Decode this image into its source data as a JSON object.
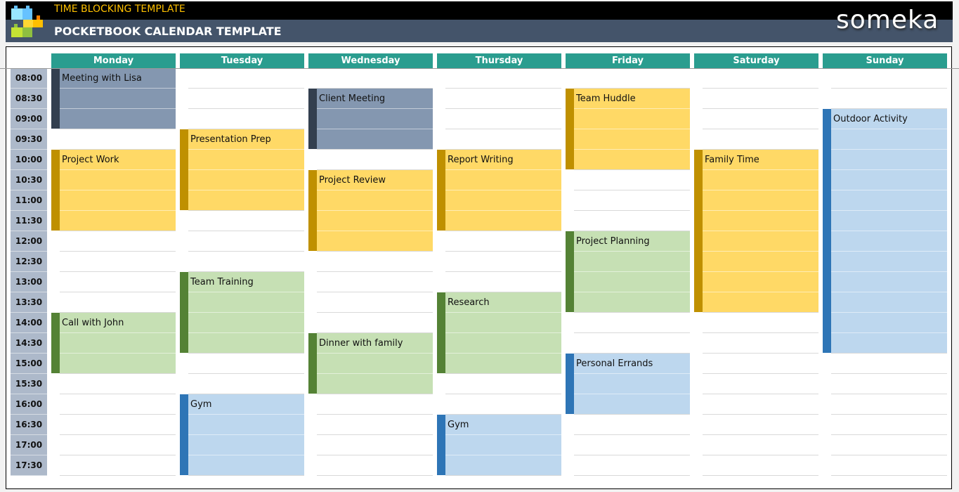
{
  "header": {
    "subtitle": "TIME BLOCKING TEMPLATE",
    "title": "POCKETBOOK CALENDAR TEMPLATE",
    "brand": "someka"
  },
  "colors": {
    "teal": "#2a9d8f",
    "slate": "#8497b0",
    "yellow": "#ffd966",
    "green": "#c6e0b4",
    "blue": "#bdd7ee"
  },
  "categories": {
    "slate": {
      "fill": "#8497b0",
      "bar": "#333f4f"
    },
    "yellow": {
      "fill": "#ffd966",
      "bar": "#bf9000"
    },
    "green": {
      "fill": "#c6e0b4",
      "bar": "#548235"
    },
    "blue": {
      "fill": "#bdd7ee",
      "bar": "#2e75b6"
    }
  },
  "days": [
    "Monday",
    "Tuesday",
    "Wednesday",
    "Thursday",
    "Friday",
    "Saturday",
    "Sunday"
  ],
  "times": [
    "08:00",
    "08:30",
    "09:00",
    "09:30",
    "10:00",
    "10:30",
    "11:00",
    "11:30",
    "12:00",
    "12:30",
    "13:00",
    "13:30",
    "14:00",
    "14:30",
    "15:00",
    "15:30",
    "16:00",
    "16:30",
    "17:00",
    "17:30"
  ],
  "events": [
    {
      "day": "Monday",
      "title": "Meeting with Lisa",
      "start": "08:00",
      "end": "09:30",
      "cat": "slate"
    },
    {
      "day": "Monday",
      "title": "Project Work",
      "start": "10:00",
      "end": "12:00",
      "cat": "yellow"
    },
    {
      "day": "Monday",
      "title": "Call with John",
      "start": "14:00",
      "end": "15:30",
      "cat": "green"
    },
    {
      "day": "Tuesday",
      "title": "Presentation Prep",
      "start": "09:30",
      "end": "11:30",
      "cat": "yellow"
    },
    {
      "day": "Tuesday",
      "title": "Team Training",
      "start": "13:00",
      "end": "15:00",
      "cat": "green"
    },
    {
      "day": "Tuesday",
      "title": "Gym",
      "start": "16:00",
      "end": "18:00",
      "cat": "blue"
    },
    {
      "day": "Wednesday",
      "title": "Client Meeting",
      "start": "08:30",
      "end": "10:00",
      "cat": "slate"
    },
    {
      "day": "Wednesday",
      "title": "Project Review",
      "start": "10:30",
      "end": "12:30",
      "cat": "yellow"
    },
    {
      "day": "Wednesday",
      "title": "Dinner with family",
      "start": "14:30",
      "end": "16:00",
      "cat": "green"
    },
    {
      "day": "Thursday",
      "title": "Report Writing",
      "start": "10:00",
      "end": "12:00",
      "cat": "yellow"
    },
    {
      "day": "Thursday",
      "title": "Research",
      "start": "13:30",
      "end": "15:30",
      "cat": "green"
    },
    {
      "day": "Thursday",
      "title": "Gym",
      "start": "16:30",
      "end": "18:00",
      "cat": "blue"
    },
    {
      "day": "Friday",
      "title": "Team Huddle",
      "start": "08:30",
      "end": "10:30",
      "cat": "yellow"
    },
    {
      "day": "Friday",
      "title": "Project Planning",
      "start": "12:00",
      "end": "14:00",
      "cat": "green"
    },
    {
      "day": "Friday",
      "title": "Personal Errands",
      "start": "15:00",
      "end": "16:30",
      "cat": "blue"
    },
    {
      "day": "Saturday",
      "title": "Family Time",
      "start": "10:00",
      "end": "14:00",
      "cat": "yellow"
    },
    {
      "day": "Sunday",
      "title": "Outdoor Activity",
      "start": "09:00",
      "end": "15:00",
      "cat": "blue"
    }
  ]
}
